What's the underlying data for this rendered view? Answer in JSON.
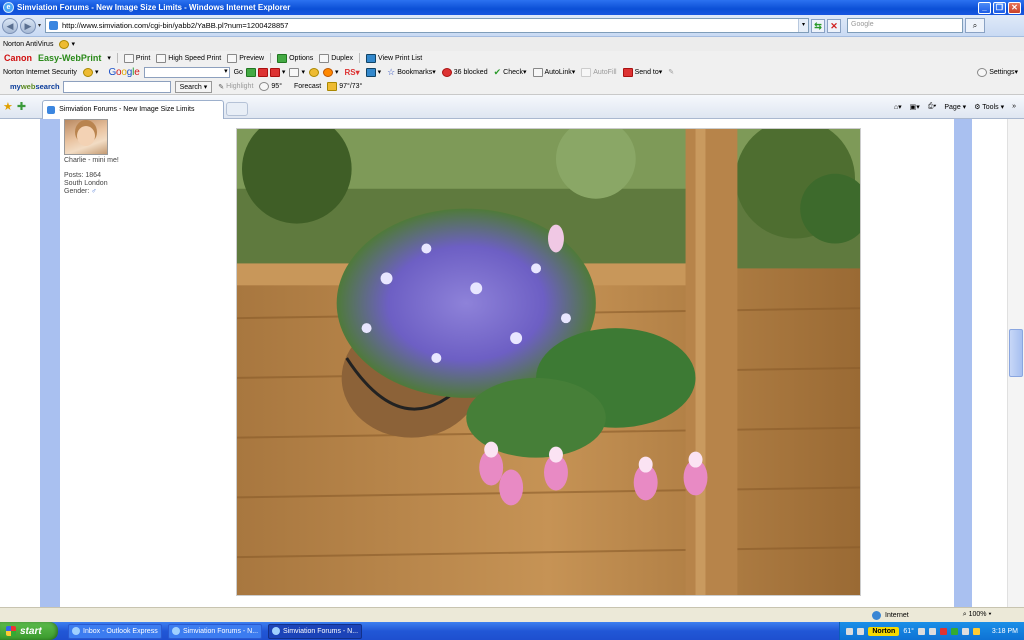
{
  "window": {
    "title": "Simviation Forums - New Image Size Limits - Windows Internet Explorer"
  },
  "address": {
    "url": "http://www.simviation.com/cgi-bin/yabb2/YaBB.pl?num=1200428857",
    "search_placeholder": "Google"
  },
  "toolbar1": {
    "norton_antivirus": "Norton AntiVirus"
  },
  "toolbar2": {
    "canon": "Canon",
    "easy_webprint": "Easy-WebPrint",
    "print": "Print",
    "high_speed_print": "High Speed Print",
    "preview": "Preview",
    "options": "Options",
    "duplex": "Duplex",
    "view_print_list": "View Print List"
  },
  "toolbar3": {
    "norton_security": "Norton Internet Security",
    "google": "Google",
    "go": "Go",
    "bookmarks": "Bookmarks",
    "blocked": "36 blocked",
    "check": "Check",
    "autolink": "AutoLink",
    "autofill": "AutoFill",
    "send_to": "Send to",
    "settings": "Settings"
  },
  "toolbar4": {
    "mywebsearch_a": "my",
    "mywebsearch_b": "web",
    "mywebsearch_c": "search",
    "search": "Search",
    "highlight": "Highlight",
    "temp": "95°",
    "forecast": "Forecast",
    "forecast_range": "97°/73°"
  },
  "tabs": {
    "active_tab": "Simviation Forums - New Image Size Limits",
    "page_menu": "Page",
    "tools_menu": "Tools"
  },
  "profile": {
    "caption": "Charlie - mini me!",
    "posts": "Posts: 1864",
    "location": "South London",
    "gender": "Gender:"
  },
  "status": {
    "zone": "Internet",
    "zoom": "100%"
  },
  "taskbar": {
    "start": "start",
    "task1": "Inbox - Outlook Express",
    "task2": "Simviation Forums - N...",
    "task3": "Simviation Forums - N...",
    "norton": "Norton",
    "temp": "61°",
    "clock": "3:18 PM"
  },
  "colors": {
    "titlebar": "#0b4fd6",
    "rail": "#a9c0f0",
    "taskbar": "#2157d6",
    "start": "#3a9a2c"
  }
}
